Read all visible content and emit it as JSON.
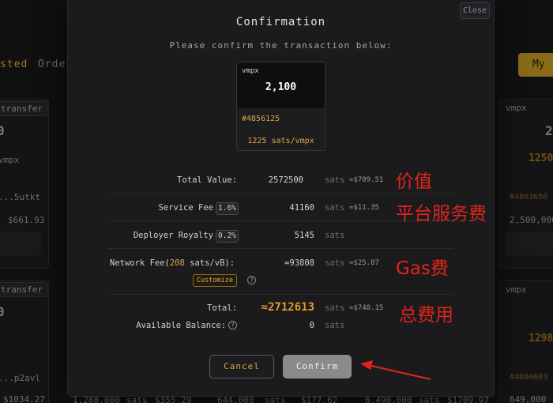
{
  "background": {
    "tabs": [
      "sted",
      "Order"
    ],
    "my_button": "My",
    "left_cards": [
      {
        "badge": "transfer",
        "amount": "0",
        "token": "vmpx",
        "inscription": "...5utkt",
        "price": "$661.93"
      },
      {
        "badge": "transfer",
        "amount": "0",
        "token": "",
        "inscription": "...p2avl",
        "price": "$1034.27"
      }
    ],
    "right_cards": [
      {
        "token": "vmpx",
        "amount": "2",
        "rate": "1250",
        "id": "#4803650",
        "total": "2,500,000"
      },
      {
        "token": "vmpx",
        "rate": "1298",
        "id": "#4880603",
        "total": "649,000"
      }
    ],
    "bottom_strip": [
      "1,288,000",
      "sats",
      "$355.29",
      "644,000",
      "sats",
      "$177.62",
      "6,490,000",
      "sats",
      "$1709.97"
    ]
  },
  "modal": {
    "close_label": "Close",
    "title": "Confirmation",
    "subtitle": "Please confirm the transaction below:",
    "token": {
      "name": "vmpx",
      "amount": "2,100",
      "id": "#4856125",
      "rate": "1225 sats/vmpx"
    },
    "rows": {
      "total_value": {
        "label": "Total Value:",
        "value": "2572500",
        "unit": "sats",
        "usd": "≈$709.51"
      },
      "service_fee": {
        "label": "Service Fee",
        "chip": "1.6%",
        "value": "41160",
        "unit": "sats",
        "usd": "≈$11.35"
      },
      "deployer_royalty": {
        "label": "Deployer Royalty",
        "chip": "0.2%",
        "value": "5145",
        "unit": "sats"
      },
      "network_fee": {
        "label": "Network Fee(",
        "rate": "208",
        "rate_unit": " sats/vB):",
        "value": "≈93808",
        "unit": "sats",
        "usd": "≈$25.87",
        "customize_label": "Customize"
      },
      "total": {
        "label": "Total:",
        "value": "≈2712613",
        "unit": "sats",
        "usd": "≈$748.15"
      },
      "available_balance": {
        "label": "Available Balance:",
        "value": "0",
        "unit": "sats"
      }
    },
    "cancel_label": "Cancel",
    "confirm_label": "Confirm"
  },
  "annotations": {
    "value": "价值",
    "platform_fee": "平台服务费",
    "gas_fee": "Gas费",
    "total_fee": "总费用"
  },
  "colors": {
    "accent_gold": "#d9a742",
    "total_orange": "#e09a2c",
    "annotation_red": "#e0241b",
    "modal_bg": "#1b1b1e"
  },
  "icons": [
    "help-icon",
    "arrow-annotation"
  ]
}
